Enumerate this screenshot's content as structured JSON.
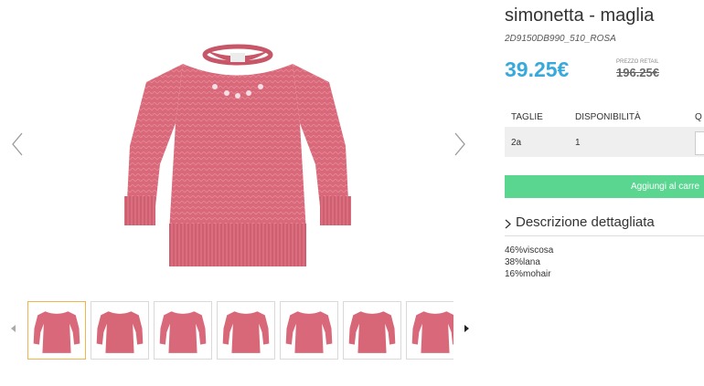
{
  "product": {
    "title": "simonetta - maglia",
    "sku": "2D9150DB990_510_ROSA",
    "price": "39.25€",
    "retail_label": "PREZZO RETAIL",
    "retail_price": "196.25€"
  },
  "availability_table": {
    "headers": [
      "TAGLIE",
      "DISPONIBILITÀ",
      "Q"
    ],
    "rows": [
      {
        "size": "2a",
        "availability": "1"
      }
    ]
  },
  "add_to_cart_label": "Aggiungi al carre",
  "description": {
    "toggle_label": "Descrizione dettagliata",
    "composition": [
      "46%viscosa",
      "38%lana",
      "16%mohair"
    ]
  },
  "gallery": {
    "thumbnail_count": 7,
    "active_thumbnail": 1
  },
  "colors": {
    "price": "#39a9dc",
    "add_button": "#5ad691",
    "active_thumb_border": "#f0b34e",
    "sweater": "#d9697a"
  },
  "icons": {
    "gallery_prev": "chevron-left-icon",
    "gallery_next": "chevron-right-icon",
    "thumbs_prev": "triangle-left-icon",
    "thumbs_next": "triangle-right-icon",
    "desc_toggle": "chevron-right-icon"
  }
}
